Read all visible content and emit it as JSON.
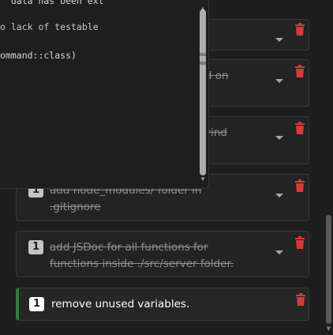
{
  "terminal": {
    "lines": [
      "  data has been ext",
      "o lack of testable",
      "ommand::class)"
    ]
  },
  "todos": [
    {
      "count": "1",
      "text": "fix missing semicolons",
      "done": true
    },
    {
      "count": "1",
      "text": "update README.md file based on current code base",
      "done": true
    },
    {
      "count": "1",
      "text": "replace custom CSS with tailwind classes",
      "done": true
    },
    {
      "count": "1",
      "text": "add node_modules/ folder in .gitignore",
      "done": true
    },
    {
      "count": "1",
      "text": "add JSDoc for all functions for functions inside ./src/server folder.",
      "done": true
    },
    {
      "count": "1",
      "text": "remove unused variables.",
      "done": false
    }
  ],
  "colors": {
    "accent_active": "#2e7d32",
    "trash": "#d83a3a"
  },
  "icons": {
    "expand": "chevron-down-icon",
    "delete": "trash-icon",
    "scroll_up": "scroll-up-arrow-icon",
    "scroll_down": "scroll-down-arrow-icon"
  }
}
